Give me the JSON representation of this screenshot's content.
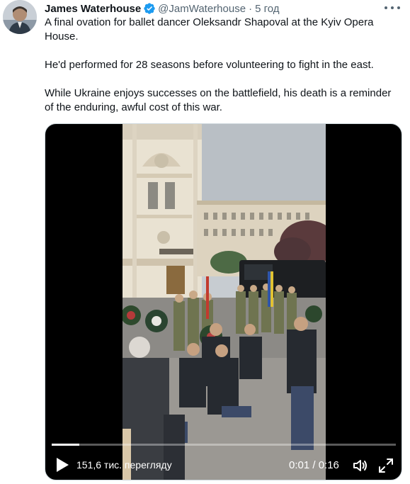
{
  "tweet": {
    "author_name": "James Waterhouse",
    "handle": "@JamWaterhouse",
    "separator": "·",
    "time": "5 год",
    "paragraphs": [
      "A final ovation for ballet dancer Oleksandr Shapoval at the Kyiv Opera House.",
      "He'd performed for 28 seasons before volunteering to fight in the east.",
      "While Ukraine enjoys successes on the battlefield, his death is a reminder of the enduring, awful cost of this war."
    ]
  },
  "video": {
    "views": "151,6 тис. перегляду",
    "timecode": "0:01 / 0:16",
    "progress": 0.08
  },
  "colors": {
    "verified_badge": "#1d9bf0",
    "text_primary": "#0f1419",
    "text_secondary": "#536471"
  },
  "icons": {
    "verified": "verified-badge-icon",
    "more": "more-options-icon",
    "play": "play-icon",
    "mute": "volume-icon",
    "fullscreen": "fullscreen-icon"
  }
}
